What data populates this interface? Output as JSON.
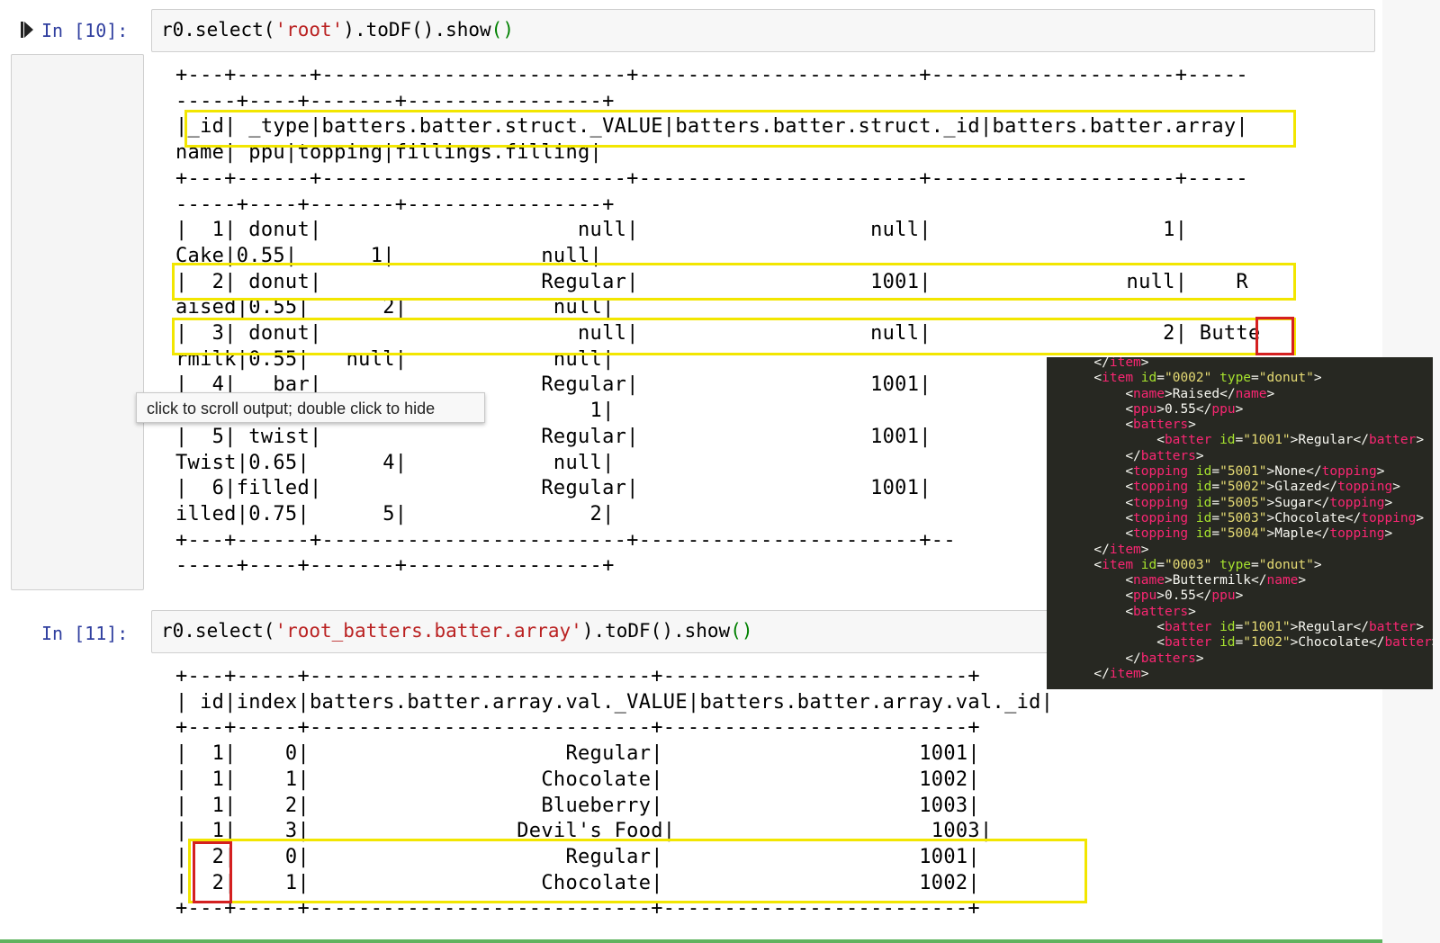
{
  "cell1": {
    "prompt": "In [10]:",
    "code_obj": "r0.select(",
    "code_str": "'root'",
    "code_mid": ").toDF().show",
    "code_parens": "()",
    "output": "+---+------+-------------------------+-----------------------+--------------------+-----\n-----+----+-------+----------------+\n|_id| _type|batters.batter.struct._VALUE|batters.batter.struct._id|batters.batter.array|\nname| ppu|topping|fillings.filling|\n+---+------+-------------------------+-----------------------+--------------------+-----\n-----+----+-------+----------------+\n|  1| donut|                     null|                   null|                   1|\nCake|0.55|      1|            null|\n|  2| donut|                  Regular|                   1001|                null|    R\naised|0.55|      2|            null|\n|  3| donut|                     null|                   null|                   2| Butte\nrmilk|0.55|   null|            null|\n|  4|   bar|                  Regular|                   1001|\n                                  1|\n|  5| twist|                  Regular|                   1001|\nTwist|0.65|      4|            null|\n|  6|filled|                  Regular|                   1001|\nilled|0.75|      5|               2|\n+---+------+-------------------------+-----------------------+--\n-----+----+-------+----------------+"
  },
  "tooltip": "click to scroll output; double click to hide",
  "cell2": {
    "prompt": "In [11]:",
    "code_obj": "r0.select(",
    "code_str": "'root_batters.batter.array'",
    "code_mid": ").toDF().show",
    "code_parens": "()",
    "output": "+---+-----+----------------------------+-------------------------+\n| id|index|batters.batter.array.val._VALUE|batters.batter.array.val._id|\n+---+-----+----------------------------+-------------------------+\n|  1|    0|                     Regular|                     1001|\n|  1|    1|                   Chocolate|                     1002|\n|  1|    2|                   Blueberry|                     1003|\n|  1|    3|                 Devil's Food|                     1003|\n|  2|    0|                     Regular|                     1001|\n|  2|    1|                   Chocolate|                     1002|\n+---+-----+----------------------------+-------------------------+"
  },
  "xml_lines": [
    {
      "indent": "      ",
      "open": "</",
      "tag": "item",
      "close": ">"
    },
    {
      "indent": "      ",
      "elem": "item",
      "attrs": [
        [
          "id",
          "\"0002\""
        ],
        [
          "type",
          "\"donut\""
        ]
      ]
    },
    {
      "indent": "          ",
      "elem": "name",
      "text": "Raised"
    },
    {
      "indent": "          ",
      "elem": "ppu",
      "text": "0.55"
    },
    {
      "indent": "          ",
      "opentag": "batters"
    },
    {
      "indent": "              ",
      "elem": "batter",
      "attrs": [
        [
          "id",
          "\"1001\""
        ]
      ],
      "text": "Regular"
    },
    {
      "indent": "          ",
      "closetag": "batters"
    },
    {
      "indent": "          ",
      "elem": "topping",
      "attrs": [
        [
          "id",
          "\"5001\""
        ]
      ],
      "text": "None"
    },
    {
      "indent": "          ",
      "elem": "topping",
      "attrs": [
        [
          "id",
          "\"5002\""
        ]
      ],
      "text": "Glazed"
    },
    {
      "indent": "          ",
      "elem": "topping",
      "attrs": [
        [
          "id",
          "\"5005\""
        ]
      ],
      "text": "Sugar"
    },
    {
      "indent": "          ",
      "elem": "topping",
      "attrs": [
        [
          "id",
          "\"5003\""
        ]
      ],
      "text": "Chocolate"
    },
    {
      "indent": "          ",
      "elem": "topping",
      "attrs": [
        [
          "id",
          "\"5004\""
        ]
      ],
      "text": "Maple"
    },
    {
      "indent": "      ",
      "closetag": "item"
    },
    {
      "indent": "      ",
      "elem": "item",
      "attrs": [
        [
          "id",
          "\"0003\""
        ],
        [
          "type",
          "\"donut\""
        ]
      ]
    },
    {
      "indent": "          ",
      "elem": "name",
      "text": "Buttermilk"
    },
    {
      "indent": "          ",
      "elem": "ppu",
      "text": "0.55"
    },
    {
      "indent": "          ",
      "opentag": "batters"
    },
    {
      "indent": "              ",
      "elem": "batter",
      "attrs": [
        [
          "id",
          "\"1001\""
        ]
      ],
      "text": "Regular"
    },
    {
      "indent": "              ",
      "elem": "batter",
      "attrs": [
        [
          "id",
          "\"1002\""
        ]
      ],
      "text": "Chocolate"
    },
    {
      "indent": "          ",
      "closetag": "batters"
    },
    {
      "indent": "      ",
      "closetag": "item"
    }
  ],
  "colors": {
    "prompt": "#303f9f",
    "string": "#ba2121",
    "paren": "#008000",
    "highlight_yellow": "#f2e600",
    "highlight_red": "#d42020",
    "xml_bg": "#272822"
  }
}
